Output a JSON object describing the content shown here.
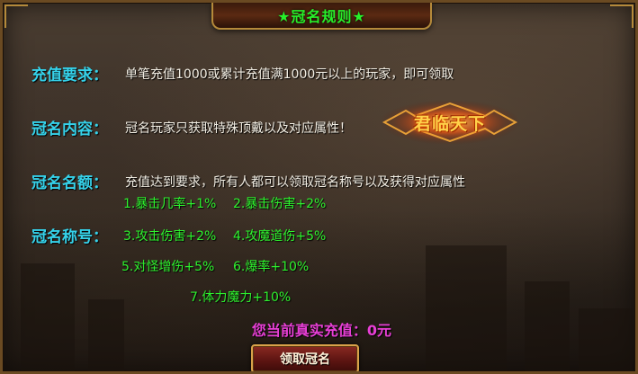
{
  "title": "★冠名规则★",
  "rules": {
    "requirement": {
      "label": "充值要求：",
      "text": "单笔充值1000或累计充值满1000元以上的玩家，即可领取"
    },
    "content": {
      "label": "冠名内容：",
      "text": "冠名玩家只获取特殊顶戴以及对应属性！"
    },
    "quota": {
      "label": "冠名名额：",
      "text": "充值达到要求，所有人都可以领取冠名称号以及获得对应属性"
    },
    "titles": {
      "label": "冠名称号："
    }
  },
  "badge_text": "君临天下",
  "attributes": [
    "1.暴击几率+1%",
    "2.暴击伤害+2%",
    "3.攻击伤害+2%",
    "4.攻魔道伤+5%",
    "5.对怪增伤+5%",
    "6.爆率+10%",
    "7.体力魔力+10%"
  ],
  "current_recharge": "您当前真实充值：0元",
  "claim_button": "领取冠名",
  "colors": {
    "title": "#27f02a",
    "label": "#35d2ea",
    "attribute": "#2ef22e",
    "recharge": "#e83fd6",
    "frame": "#b58a3a"
  }
}
